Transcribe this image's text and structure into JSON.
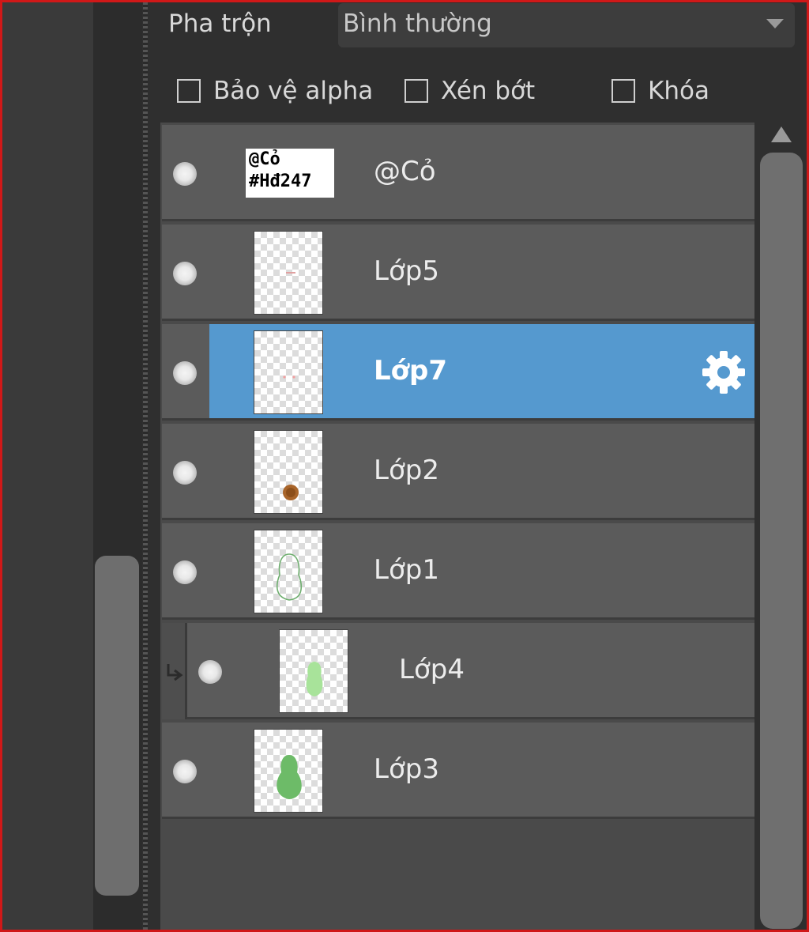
{
  "blend": {
    "label": "Pha trộn",
    "value": "Bình thường"
  },
  "options": [
    {
      "label": "Bảo vệ alpha",
      "checked": false
    },
    {
      "label": "Xén bớt",
      "checked": false
    },
    {
      "label": "Khóa",
      "checked": false
    }
  ],
  "layers": [
    {
      "name": "@Cỏ",
      "thumb_text": [
        "@Cỏ",
        "#Hđ247"
      ]
    },
    {
      "name": "Lớp5"
    },
    {
      "name": "Lớp7",
      "selected": true
    },
    {
      "name": "Lớp2"
    },
    {
      "name": "Lớp1"
    },
    {
      "name": "Lớp4",
      "clipped": true
    },
    {
      "name": "Lớp3"
    }
  ],
  "colors": {
    "selection": "#5599cf",
    "row": "#5b5b5b",
    "panel": "#2f2f2f"
  }
}
